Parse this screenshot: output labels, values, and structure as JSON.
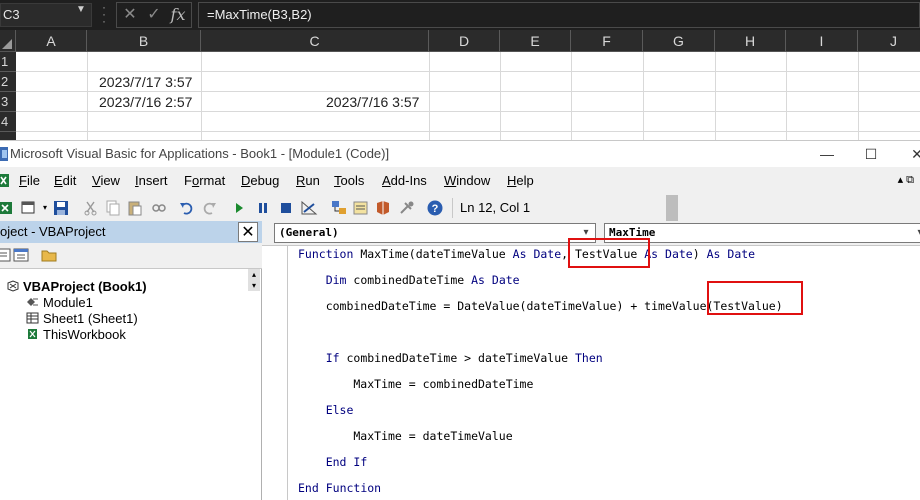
{
  "excel": {
    "name_box": "C3",
    "formula": "=MaxTime(B3,B2)",
    "fx_cancel": "✕",
    "fx_enter": "✓",
    "fx_label": "fx",
    "columns": [
      "A",
      "B",
      "C",
      "D",
      "E",
      "F",
      "G",
      "H",
      "I",
      "J"
    ],
    "rows": [
      "1",
      "2",
      "3",
      "4"
    ],
    "cells": {
      "B2": "2023/7/17 3:57",
      "B3": "2023/7/16 2:57",
      "C3": "2023/7/16 3:57"
    }
  },
  "vbe": {
    "title": "Microsoft Visual Basic for Applications - Book1 - [Module1 (Code)]",
    "window_buttons": {
      "minimize": "—",
      "maximize": "☐",
      "close": "✕"
    },
    "menus": [
      {
        "label": "File",
        "key": "F",
        "rest": "ile"
      },
      {
        "label": "Edit",
        "key": "E",
        "rest": "dit"
      },
      {
        "label": "View",
        "key": "V",
        "rest": "iew"
      },
      {
        "label": "Insert",
        "key": "I",
        "rest": "nsert"
      },
      {
        "label": "Format",
        "key": "o",
        "pre": "F",
        "rest": "rmat"
      },
      {
        "label": "Debug",
        "key": "D",
        "rest": "ebug"
      },
      {
        "label": "Run",
        "key": "R",
        "rest": "un"
      },
      {
        "label": "Tools",
        "key": "T",
        "rest": "ools"
      },
      {
        "label": "Add-Ins",
        "key": "A",
        "rest": "dd-Ins"
      },
      {
        "label": "Window",
        "key": "W",
        "rest": "indow"
      },
      {
        "label": "Help",
        "key": "H",
        "rest": "elp"
      }
    ],
    "status_position": "Ln 12, Col 1",
    "project": {
      "title": "oject - VBAProject",
      "root": "VBAProject (Book1)",
      "items": [
        "Module1",
        "Sheet1 (Sheet1)",
        "ThisWorkbook"
      ]
    },
    "code": {
      "object_combo": "(General)",
      "proc_combo": "MaxTime",
      "lines": [
        "Function MaxTime(dateTimeValue As Date, TestValue As Date) As Date",
        "    Dim combinedDateTime As Date",
        "    combinedDateTime = DateValue(dateTimeValue) + timeValue(TestValue)",
        "",
        "    If combinedDateTime > dateTimeValue Then",
        "        MaxTime = combinedDateTime",
        "    Else",
        "        MaxTime = dateTimeValue",
        "    End If",
        "End Function"
      ],
      "highlight_color": "#e01010"
    }
  }
}
